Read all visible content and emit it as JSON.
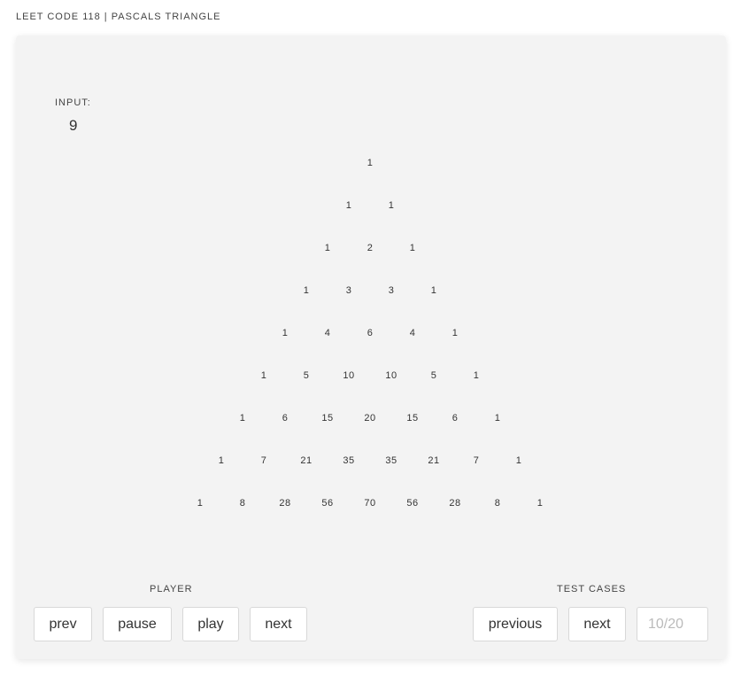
{
  "header": {
    "title": "LEET CODE 118 | PASCALS TRIANGLE"
  },
  "input": {
    "label": "INPUT:",
    "value": "9"
  },
  "triangle": {
    "rows": [
      [
        1
      ],
      [
        1,
        1
      ],
      [
        1,
        2,
        1
      ],
      [
        1,
        3,
        3,
        1
      ],
      [
        1,
        4,
        6,
        4,
        1
      ],
      [
        1,
        5,
        10,
        10,
        5,
        1
      ],
      [
        1,
        6,
        15,
        20,
        15,
        6,
        1
      ],
      [
        1,
        7,
        21,
        35,
        35,
        21,
        7,
        1
      ],
      [
        1,
        8,
        28,
        56,
        70,
        56,
        28,
        8,
        1
      ]
    ]
  },
  "player": {
    "label": "PLAYER",
    "prev_label": "prev",
    "pause_label": "pause",
    "play_label": "play",
    "next_label": "next"
  },
  "test_cases": {
    "label": "TEST CASES",
    "previous_label": "previous",
    "next_label": "next",
    "placeholder": "10/20"
  }
}
